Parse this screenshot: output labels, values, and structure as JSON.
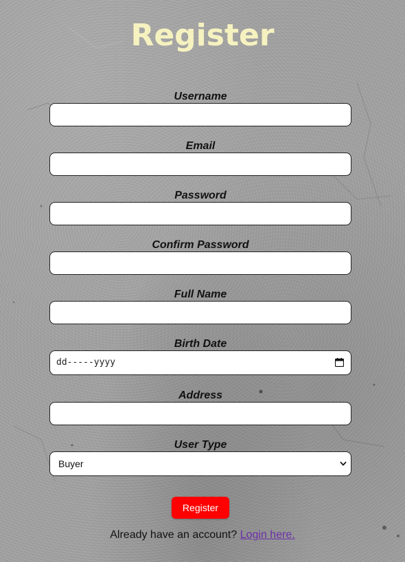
{
  "page": {
    "title": "Register"
  },
  "form": {
    "username": {
      "label": "Username",
      "value": "",
      "placeholder": ""
    },
    "email": {
      "label": "Email",
      "value": "",
      "placeholder": ""
    },
    "password": {
      "label": "Password",
      "value": "",
      "placeholder": ""
    },
    "confirm_password": {
      "label": "Confirm Password",
      "value": "",
      "placeholder": ""
    },
    "full_name": {
      "label": "Full Name",
      "value": "",
      "placeholder": ""
    },
    "birth_date": {
      "label": "Birth Date",
      "display_text": "dd-----yyyy",
      "icon": "calendar-icon"
    },
    "address": {
      "label": "Address",
      "value": "",
      "placeholder": ""
    },
    "user_type": {
      "label": "User Type",
      "selected": "Buyer",
      "icon": "chevron-down-icon"
    },
    "submit_label": "Register"
  },
  "footer": {
    "prompt": "Already have an account?",
    "link_text": "Login here."
  },
  "colors": {
    "title": "#f6f2c0",
    "button_bg": "#ff0000",
    "button_text": "#ffffff",
    "link": "#6a2ea8",
    "background": "#a2a2a2"
  }
}
